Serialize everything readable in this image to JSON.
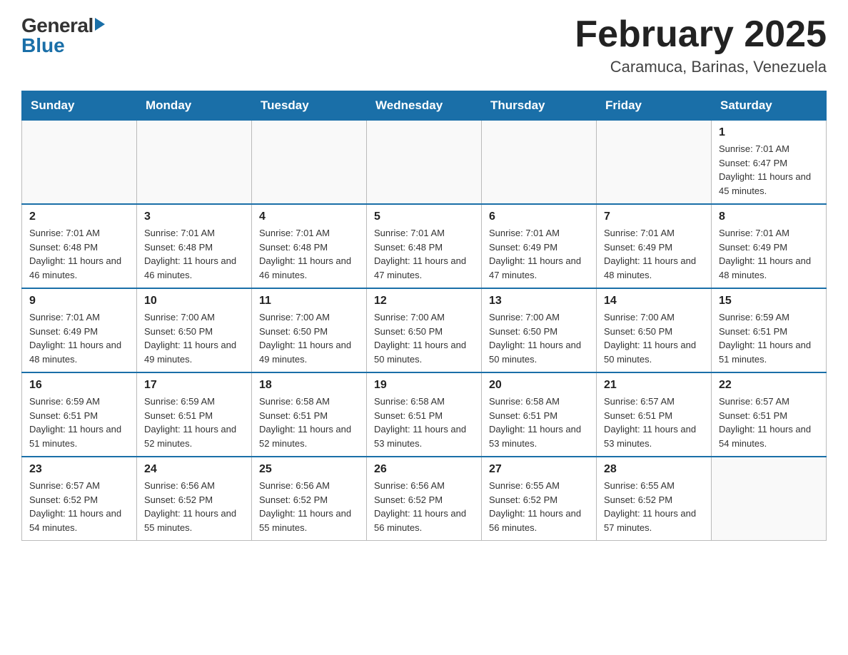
{
  "header": {
    "logo": {
      "general": "General",
      "blue": "Blue"
    },
    "title": "February 2025",
    "location": "Caramuca, Barinas, Venezuela"
  },
  "calendar": {
    "days_of_week": [
      "Sunday",
      "Monday",
      "Tuesday",
      "Wednesday",
      "Thursday",
      "Friday",
      "Saturday"
    ],
    "weeks": [
      [
        {
          "day": "",
          "info": ""
        },
        {
          "day": "",
          "info": ""
        },
        {
          "day": "",
          "info": ""
        },
        {
          "day": "",
          "info": ""
        },
        {
          "day": "",
          "info": ""
        },
        {
          "day": "",
          "info": ""
        },
        {
          "day": "1",
          "info": "Sunrise: 7:01 AM\nSunset: 6:47 PM\nDaylight: 11 hours and 45 minutes."
        }
      ],
      [
        {
          "day": "2",
          "info": "Sunrise: 7:01 AM\nSunset: 6:48 PM\nDaylight: 11 hours and 46 minutes."
        },
        {
          "day": "3",
          "info": "Sunrise: 7:01 AM\nSunset: 6:48 PM\nDaylight: 11 hours and 46 minutes."
        },
        {
          "day": "4",
          "info": "Sunrise: 7:01 AM\nSunset: 6:48 PM\nDaylight: 11 hours and 46 minutes."
        },
        {
          "day": "5",
          "info": "Sunrise: 7:01 AM\nSunset: 6:48 PM\nDaylight: 11 hours and 47 minutes."
        },
        {
          "day": "6",
          "info": "Sunrise: 7:01 AM\nSunset: 6:49 PM\nDaylight: 11 hours and 47 minutes."
        },
        {
          "day": "7",
          "info": "Sunrise: 7:01 AM\nSunset: 6:49 PM\nDaylight: 11 hours and 48 minutes."
        },
        {
          "day": "8",
          "info": "Sunrise: 7:01 AM\nSunset: 6:49 PM\nDaylight: 11 hours and 48 minutes."
        }
      ],
      [
        {
          "day": "9",
          "info": "Sunrise: 7:01 AM\nSunset: 6:49 PM\nDaylight: 11 hours and 48 minutes."
        },
        {
          "day": "10",
          "info": "Sunrise: 7:00 AM\nSunset: 6:50 PM\nDaylight: 11 hours and 49 minutes."
        },
        {
          "day": "11",
          "info": "Sunrise: 7:00 AM\nSunset: 6:50 PM\nDaylight: 11 hours and 49 minutes."
        },
        {
          "day": "12",
          "info": "Sunrise: 7:00 AM\nSunset: 6:50 PM\nDaylight: 11 hours and 50 minutes."
        },
        {
          "day": "13",
          "info": "Sunrise: 7:00 AM\nSunset: 6:50 PM\nDaylight: 11 hours and 50 minutes."
        },
        {
          "day": "14",
          "info": "Sunrise: 7:00 AM\nSunset: 6:50 PM\nDaylight: 11 hours and 50 minutes."
        },
        {
          "day": "15",
          "info": "Sunrise: 6:59 AM\nSunset: 6:51 PM\nDaylight: 11 hours and 51 minutes."
        }
      ],
      [
        {
          "day": "16",
          "info": "Sunrise: 6:59 AM\nSunset: 6:51 PM\nDaylight: 11 hours and 51 minutes."
        },
        {
          "day": "17",
          "info": "Sunrise: 6:59 AM\nSunset: 6:51 PM\nDaylight: 11 hours and 52 minutes."
        },
        {
          "day": "18",
          "info": "Sunrise: 6:58 AM\nSunset: 6:51 PM\nDaylight: 11 hours and 52 minutes."
        },
        {
          "day": "19",
          "info": "Sunrise: 6:58 AM\nSunset: 6:51 PM\nDaylight: 11 hours and 53 minutes."
        },
        {
          "day": "20",
          "info": "Sunrise: 6:58 AM\nSunset: 6:51 PM\nDaylight: 11 hours and 53 minutes."
        },
        {
          "day": "21",
          "info": "Sunrise: 6:57 AM\nSunset: 6:51 PM\nDaylight: 11 hours and 53 minutes."
        },
        {
          "day": "22",
          "info": "Sunrise: 6:57 AM\nSunset: 6:51 PM\nDaylight: 11 hours and 54 minutes."
        }
      ],
      [
        {
          "day": "23",
          "info": "Sunrise: 6:57 AM\nSunset: 6:52 PM\nDaylight: 11 hours and 54 minutes."
        },
        {
          "day": "24",
          "info": "Sunrise: 6:56 AM\nSunset: 6:52 PM\nDaylight: 11 hours and 55 minutes."
        },
        {
          "day": "25",
          "info": "Sunrise: 6:56 AM\nSunset: 6:52 PM\nDaylight: 11 hours and 55 minutes."
        },
        {
          "day": "26",
          "info": "Sunrise: 6:56 AM\nSunset: 6:52 PM\nDaylight: 11 hours and 56 minutes."
        },
        {
          "day": "27",
          "info": "Sunrise: 6:55 AM\nSunset: 6:52 PM\nDaylight: 11 hours and 56 minutes."
        },
        {
          "day": "28",
          "info": "Sunrise: 6:55 AM\nSunset: 6:52 PM\nDaylight: 11 hours and 57 minutes."
        },
        {
          "day": "",
          "info": ""
        }
      ]
    ]
  }
}
